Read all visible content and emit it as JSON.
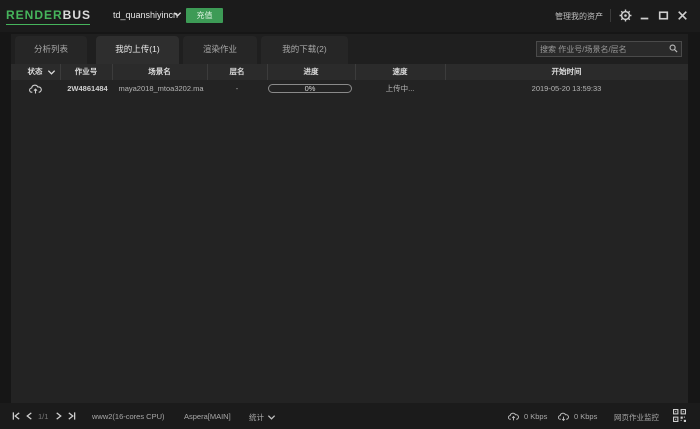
{
  "app": {
    "logo_prefix": "RENDER",
    "logo_suffix": "BUS",
    "username": "td_quanshiyincn",
    "recharge_label": "充值",
    "manage_assets_label": "管理我的资产"
  },
  "tabs": [
    {
      "label": "分析列表",
      "active": false
    },
    {
      "label": "我的上传(1)",
      "active": true
    },
    {
      "label": "渲染作业",
      "active": false
    },
    {
      "label": "我的下载(2)",
      "active": false
    }
  ],
  "search": {
    "placeholder": "搜索 作业号/场景名/层名"
  },
  "table": {
    "columns": [
      "状态",
      "作业号",
      "场景名",
      "层名",
      "进度",
      "速度",
      "开始时间"
    ],
    "rows": [
      {
        "status_icon": "cloud-upload-icon",
        "job_id": "2W4861484",
        "scene": "maya2018_mtoa3202.ma",
        "layer": "-",
        "progress": 0,
        "progress_label": "0%",
        "speed": "上传中...",
        "start_time": "2019-05-20 13:59:33"
      }
    ]
  },
  "bottom": {
    "page_label": "1/1",
    "server": "www2(16-cores CPU)",
    "transfer": "Aspera[MAIN]",
    "stats": "统计",
    "upload_speed": "0 Kbps",
    "download_speed": "0 Kbps",
    "web_monitor": "网页作业监控"
  },
  "colors": {
    "accent": "#46b45c",
    "background": "#161616",
    "panel": "#232323"
  }
}
